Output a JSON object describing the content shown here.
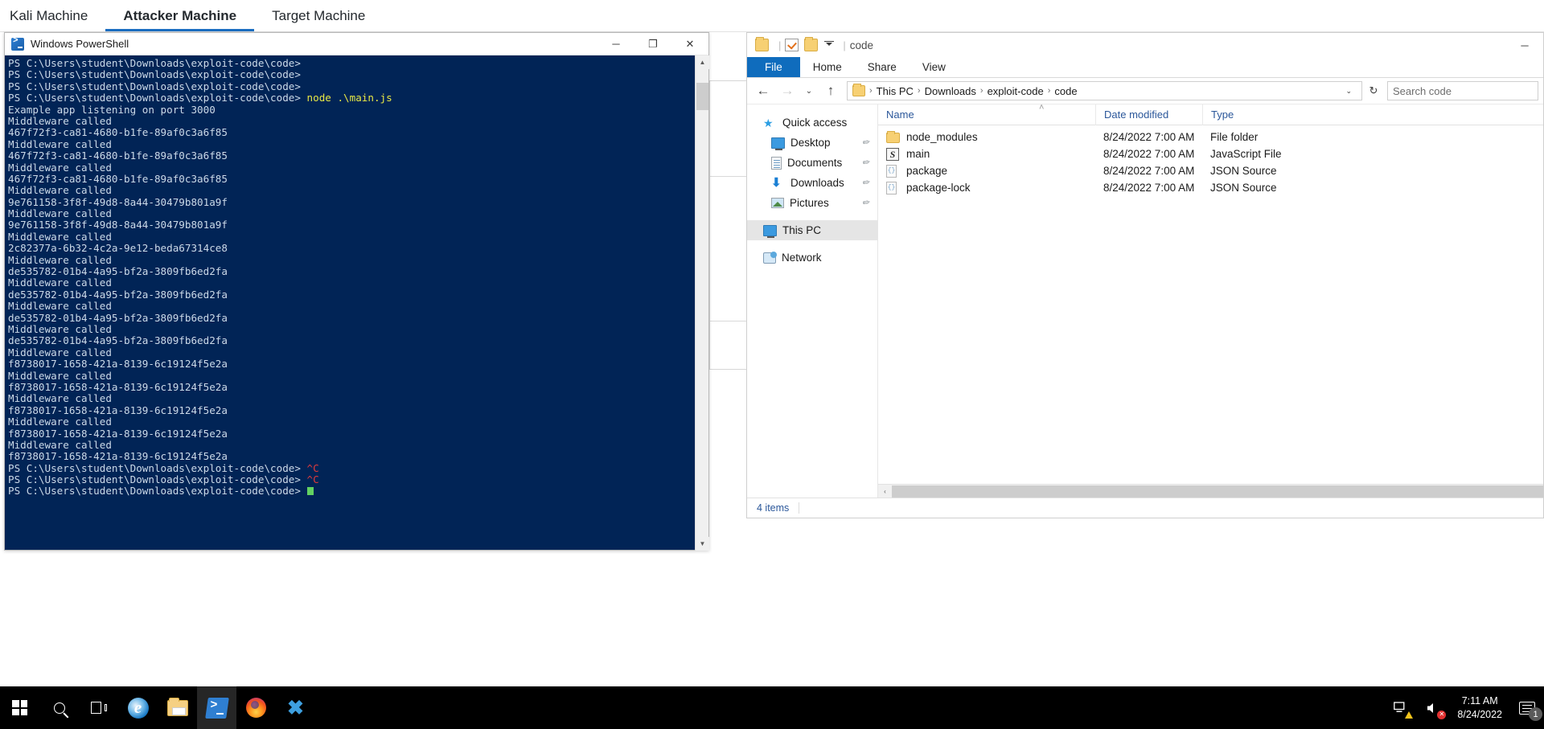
{
  "machine_tabs": [
    {
      "label": "Kali Machine",
      "active": false
    },
    {
      "label": "Attacker Machine",
      "active": true
    },
    {
      "label": "Target Machine",
      "active": false
    }
  ],
  "powershell": {
    "title": "Windows PowerShell",
    "icon": "powershell-icon",
    "minimize_label": "─",
    "maximize_label": "❐",
    "close_label": "✕",
    "prompt": "PS C:\\Users\\student\\Downloads\\exploit-code\\code>",
    "scroll_up_label": "▲",
    "scroll_down_label": "▼",
    "lines": [
      {
        "prompt": true,
        "text": ""
      },
      {
        "prompt": true,
        "text": ""
      },
      {
        "prompt": true,
        "text": ""
      },
      {
        "prompt": true,
        "cmd": " node .\\main.js"
      },
      {
        "text": "Example app listening on port 3000"
      },
      {
        "text": "Middleware called"
      },
      {
        "text": "467f72f3-ca81-4680-b1fe-89af0c3a6f85"
      },
      {
        "text": "Middleware called"
      },
      {
        "text": "467f72f3-ca81-4680-b1fe-89af0c3a6f85"
      },
      {
        "text": "Middleware called"
      },
      {
        "text": "467f72f3-ca81-4680-b1fe-89af0c3a6f85"
      },
      {
        "text": "Middleware called"
      },
      {
        "text": "9e761158-3f8f-49d8-8a44-30479b801a9f"
      },
      {
        "text": "Middleware called"
      },
      {
        "text": "9e761158-3f8f-49d8-8a44-30479b801a9f"
      },
      {
        "text": "Middleware called"
      },
      {
        "text": "2c82377a-6b32-4c2a-9e12-beda67314ce8"
      },
      {
        "text": "Middleware called"
      },
      {
        "text": "de535782-01b4-4a95-bf2a-3809fb6ed2fa"
      },
      {
        "text": "Middleware called"
      },
      {
        "text": "de535782-01b4-4a95-bf2a-3809fb6ed2fa"
      },
      {
        "text": "Middleware called"
      },
      {
        "text": "de535782-01b4-4a95-bf2a-3809fb6ed2fa"
      },
      {
        "text": "Middleware called"
      },
      {
        "text": "de535782-01b4-4a95-bf2a-3809fb6ed2fa"
      },
      {
        "text": "Middleware called"
      },
      {
        "text": "f8738017-1658-421a-8139-6c19124f5e2a"
      },
      {
        "text": "Middleware called"
      },
      {
        "text": "f8738017-1658-421a-8139-6c19124f5e2a"
      },
      {
        "text": "Middleware called"
      },
      {
        "text": "f8738017-1658-421a-8139-6c19124f5e2a"
      },
      {
        "text": "Middleware called"
      },
      {
        "text": "f8738017-1658-421a-8139-6c19124f5e2a"
      },
      {
        "text": "Middleware called"
      },
      {
        "text": "f8738017-1658-421a-8139-6c19124f5e2a"
      },
      {
        "prompt": true,
        "err": " ^C"
      },
      {
        "prompt": true,
        "err": " ^C"
      },
      {
        "prompt": true,
        "cursor": true
      }
    ]
  },
  "explorer": {
    "title": "code",
    "quick_access_toolbar": [
      {
        "name": "folder-icon"
      },
      {
        "name": "properties-icon"
      },
      {
        "name": "new-folder-icon"
      }
    ],
    "minimize_label": "─",
    "ribbon_tabs": [
      {
        "label": "File",
        "active": true
      },
      {
        "label": "Home",
        "active": false
      },
      {
        "label": "Share",
        "active": false
      },
      {
        "label": "View",
        "active": false
      }
    ],
    "nav": {
      "back_label": "←",
      "forward_label": "→",
      "recent_label": "⌄",
      "up_label": "↑",
      "refresh_label": "↻",
      "dropdown_label": "⌄"
    },
    "breadcrumbs": [
      "This PC",
      "Downloads",
      "exploit-code",
      "code"
    ],
    "breadcrumb_separator": "›",
    "search": {
      "placeholder": "Search code",
      "value": ""
    },
    "sidebar": [
      {
        "label": "Quick access",
        "icon": "star-icon",
        "indent": false,
        "pinned": false,
        "selected": false
      },
      {
        "label": "Desktop",
        "icon": "monitor-icon",
        "indent": true,
        "pinned": true,
        "selected": false
      },
      {
        "label": "Documents",
        "icon": "document-icon",
        "indent": true,
        "pinned": true,
        "selected": false
      },
      {
        "label": "Downloads",
        "icon": "download-arrow-icon",
        "indent": true,
        "pinned": true,
        "selected": false
      },
      {
        "label": "Pictures",
        "icon": "picture-icon",
        "indent": true,
        "pinned": true,
        "selected": false
      },
      {
        "label": "This PC",
        "icon": "this-pc-icon",
        "indent": false,
        "pinned": false,
        "selected": true
      },
      {
        "label": "Network",
        "icon": "network-icon",
        "indent": false,
        "pinned": false,
        "selected": false
      }
    ],
    "pin_glyph": "📌",
    "columns": [
      {
        "label": "Name",
        "sorted": true
      },
      {
        "label": "Date modified",
        "sorted": false
      },
      {
        "label": "Type",
        "sorted": false
      }
    ],
    "sort_caret": "˄",
    "files": [
      {
        "name": "node_modules",
        "date": "8/24/2022 7:00 AM",
        "type": "File folder",
        "icon": "folder-icon"
      },
      {
        "name": "main",
        "date": "8/24/2022 7:00 AM",
        "type": "JavaScript File",
        "icon": "javascript-file-icon"
      },
      {
        "name": "package",
        "date": "8/24/2022 7:00 AM",
        "type": "JSON Source",
        "icon": "json-file-icon"
      },
      {
        "name": "package-lock",
        "date": "8/24/2022 7:00 AM",
        "type": "JSON Source",
        "icon": "json-file-icon"
      }
    ],
    "hscroll_left_label": "‹",
    "hscroll_right_label": "›",
    "status": "4 items"
  },
  "taskbar": {
    "items": [
      {
        "name": "start-button",
        "icon": "windows-logo-icon"
      },
      {
        "name": "search-button",
        "icon": "search-icon"
      },
      {
        "name": "task-view-button",
        "icon": "task-view-icon"
      },
      {
        "name": "internet-explorer-button",
        "icon": "internet-explorer-icon",
        "glyph": "e"
      },
      {
        "name": "file-explorer-button",
        "icon": "folder-icon"
      },
      {
        "name": "powershell-button",
        "icon": "powershell-icon",
        "active": true
      },
      {
        "name": "firefox-button",
        "icon": "firefox-icon"
      },
      {
        "name": "vscode-button",
        "icon": "vscode-icon",
        "glyph": "✖"
      }
    ],
    "tray": {
      "network_icon": "network-warning-icon",
      "volume_icon": "volume-muted-icon",
      "volume_badge": "✕",
      "time": "7:11 AM",
      "date": "8/24/2022",
      "action_center_icon": "action-center-icon",
      "notification_count": "1"
    }
  },
  "colors": {
    "powershell_bg": "#012456",
    "powershell_fg": "#ccd9e8",
    "command_yellow": "#e8e845",
    "error_red": "#e23b3b",
    "cursor_green": "#62d162",
    "ribbon_file_blue": "#0f6cbd",
    "tab_active_blue": "#1b6ec2",
    "status_blue": "#2b579a"
  }
}
